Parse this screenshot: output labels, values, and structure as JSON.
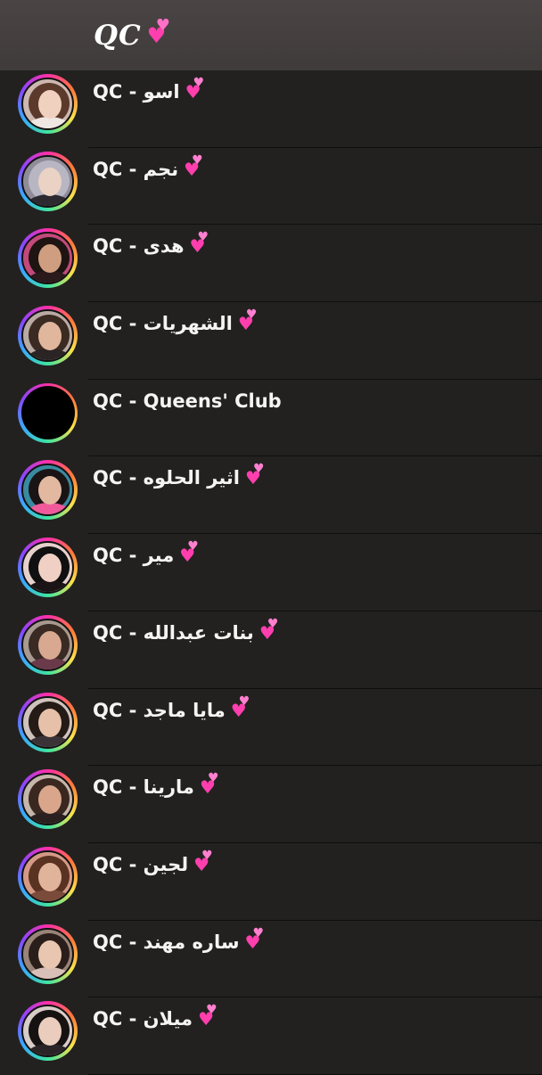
{
  "header": {
    "title": "QC",
    "icon": "two-hearts-icon"
  },
  "chats": [
    {
      "prefix": "QC - ",
      "name": "اسو",
      "heart": true,
      "avatar": {
        "hair": "#5b3a2c",
        "skin": "#f0d1c0",
        "body": "#efe7e2",
        "bg": "#cdb8b0"
      }
    },
    {
      "prefix": "QC - ",
      "name": "نجم",
      "heart": true,
      "avatar": {
        "hair": "#b9b6c4",
        "skin": "#ead2c4",
        "body": "#2c2a30",
        "bg": "#8f8c98"
      }
    },
    {
      "prefix": "QC - ",
      "name": "هدى",
      "heart": true,
      "avatar": {
        "hair": "#1e1412",
        "skin": "#cf9e80",
        "body": "#2a1a1c",
        "bg": "#c24a7a"
      }
    },
    {
      "prefix": "QC - ",
      "name": "الشهريات",
      "heart": true,
      "avatar": {
        "hair": "#3a2a22",
        "skin": "#e0b79c",
        "body": "#2a2424",
        "bg": "#b9aaa4"
      }
    },
    {
      "prefix": "QC - ",
      "name": "Queens' Club",
      "heart": false,
      "avatar": {
        "hair": "#000000",
        "skin": "#000000",
        "body": "#000000",
        "bg": "#000000"
      }
    },
    {
      "prefix": "QC - ",
      "name": "اثير الحلوه",
      "heart": true,
      "avatar": {
        "hair": "#1a1414",
        "skin": "#e3b8a0",
        "body": "#f05a9a",
        "bg": "#3a8aa0"
      }
    },
    {
      "prefix": "QC - ",
      "name": "مير",
      "heart": true,
      "avatar": {
        "hair": "#111011",
        "skin": "#f0d0c4",
        "body": "#1a1416",
        "bg": "#e6d0cc"
      }
    },
    {
      "prefix": "QC - ",
      "name": "بنات عبدالله",
      "heart": true,
      "avatar": {
        "hair": "#3a2a24",
        "skin": "#d8a890",
        "body": "#6a3a4a",
        "bg": "#a89a90"
      }
    },
    {
      "prefix": "QC - ",
      "name": "مايا ماجد",
      "heart": true,
      "avatar": {
        "hair": "#241a16",
        "skin": "#e6c0a8",
        "body": "#3a3236",
        "bg": "#cfc2bc"
      }
    },
    {
      "prefix": "QC - ",
      "name": "مارينا",
      "heart": true,
      "avatar": {
        "hair": "#3a2820",
        "skin": "#d9a68c",
        "body": "#2a2020",
        "bg": "#c4b6aa"
      }
    },
    {
      "prefix": "QC - ",
      "name": "لجين",
      "heart": true,
      "avatar": {
        "hair": "#5a3222",
        "skin": "#e0b49a",
        "body": "#7a4a3a",
        "bg": "#d49a86"
      }
    },
    {
      "prefix": "QC - ",
      "name": "ساره مهند",
      "heart": true,
      "avatar": {
        "hair": "#2a1e1a",
        "skin": "#e8c6b0",
        "body": "#d8c0b8",
        "bg": "#9a8478"
      }
    },
    {
      "prefix": "QC - ",
      "name": "ميلان",
      "heart": true,
      "avatar": {
        "hair": "#161212",
        "skin": "#ebcdbd",
        "body": "#2a2426",
        "bg": "#d8ccc8"
      }
    }
  ]
}
